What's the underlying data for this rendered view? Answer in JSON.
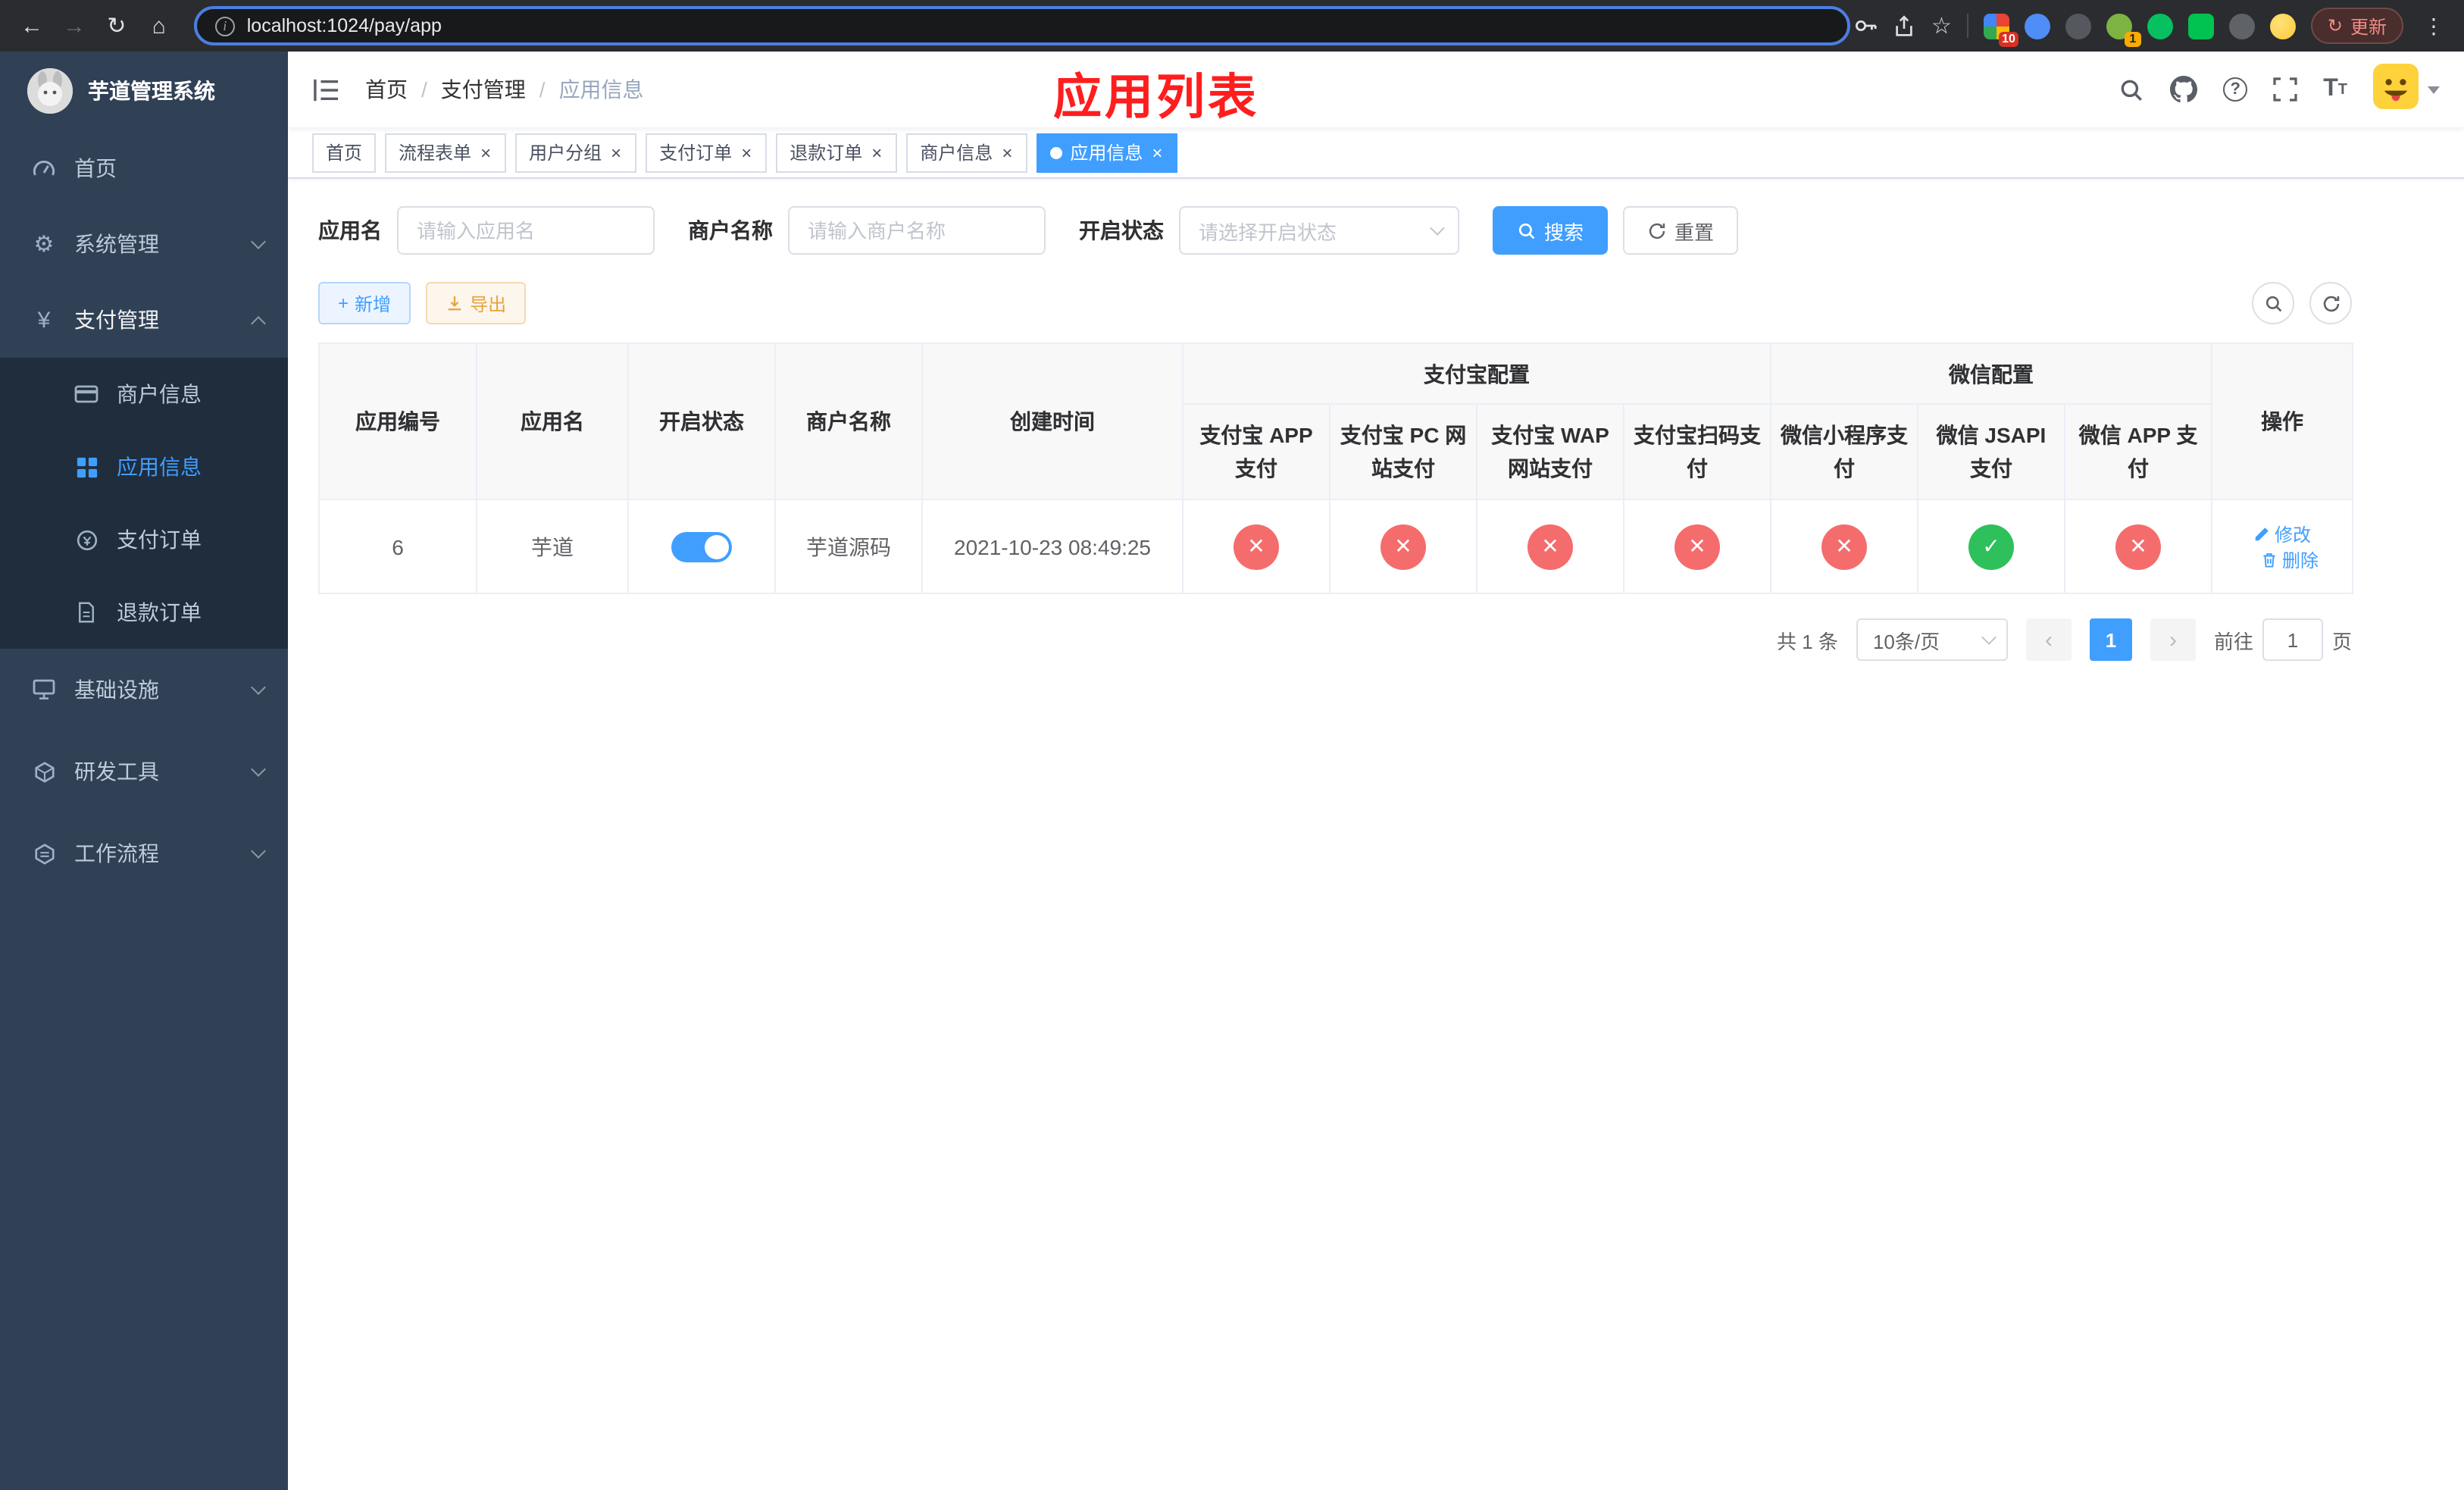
{
  "colors": {
    "accent": "#409eff",
    "danger": "#f56c6c",
    "success": "#2ec05a",
    "annotation": "#ff1e1e",
    "sidebar_bg": "#304156",
    "submenu_bg": "#1f2d3d"
  },
  "browser": {
    "url": "localhost:1024/pay/app",
    "update_label": "更新",
    "extension_badge_grid": "10",
    "extension_badge_translate": "1"
  },
  "icons": {
    "back": "←",
    "forward": "→",
    "reload": "↻",
    "home": "⌂",
    "info": "i",
    "star": "☆",
    "more": "⋮",
    "gear": "⚙",
    "yen": "¥",
    "question": "?",
    "font_size": "T",
    "close": "×",
    "plus": "+",
    "check": "✓",
    "cross": "✕",
    "prev": "‹",
    "next": "›"
  },
  "sidebar": {
    "app_title": "芋道管理系统",
    "menu_home": "首页",
    "menu_system": "系统管理",
    "menu_payment": "支付管理",
    "menu_infra": "基础设施",
    "menu_devtools": "研发工具",
    "menu_workflow": "工作流程",
    "submenu_merchant": "商户信息",
    "submenu_app": "应用信息",
    "submenu_pay_order": "支付订单",
    "submenu_refund_order": "退款订单"
  },
  "header": {
    "breadcrumb": [
      "首页",
      "支付管理",
      "应用信息"
    ],
    "separator": "/",
    "annotation": "应用列表"
  },
  "tabs": {
    "items": [
      "首页",
      "流程表单",
      "用户分组",
      "支付订单",
      "退款订单",
      "商户信息",
      "应用信息"
    ],
    "active": "应用信息"
  },
  "filters": {
    "app_name_label": "应用名",
    "app_name_placeholder": "请输入应用名",
    "merchant_label": "商户名称",
    "merchant_placeholder": "请输入商户名称",
    "status_label": "开启状态",
    "status_placeholder": "请选择开启状态",
    "search_label": "搜索",
    "reset_label": "重置"
  },
  "toolbar": {
    "add_label": "新增",
    "export_label": "导出"
  },
  "table": {
    "columns": {
      "id": "应用编号",
      "name": "应用名",
      "status": "开启状态",
      "merchant": "商户名称",
      "created": "创建时间",
      "alipay_group": "支付宝配置",
      "wechat_group": "微信配置",
      "actions": "操作"
    },
    "sub_columns": [
      "支付宝 APP 支付",
      "支付宝 PC 网站支付",
      "支付宝 WAP 网站支付",
      "支付宝扫码支付",
      "微信小程序支付",
      "微信 JSAPI 支付",
      "微信 APP 支付"
    ],
    "rows": [
      {
        "id": "6",
        "name": "芋道",
        "enabled": "on",
        "merchant": "芋道源码",
        "created": "2021-10-23 08:49:25",
        "channels": [
          "off",
          "off",
          "off",
          "off",
          "off",
          "on",
          "off"
        ],
        "edit_label": "修改",
        "delete_label": "删除"
      }
    ]
  },
  "pagination": {
    "total": "共 1 条",
    "page_size": "10条/页",
    "page": "1",
    "goto_prefix": "前往",
    "goto_value": "1",
    "goto_suffix": "页"
  }
}
